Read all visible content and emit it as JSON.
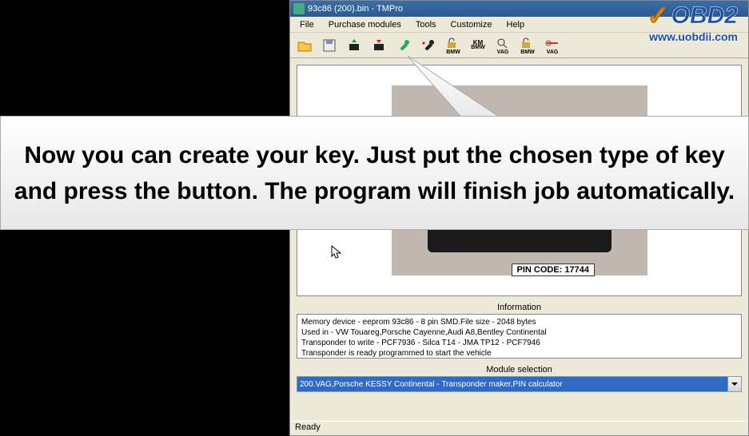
{
  "window": {
    "title": "93c86 (200).bin - TMPro"
  },
  "menu": {
    "file": "File",
    "purchase": "Purchase modules",
    "tools": "Tools",
    "customize": "Customize",
    "help": "Help"
  },
  "toolbar": {
    "bmw1": "BMW",
    "km_bmw": "KM",
    "bmw2": "BMW",
    "vag1": "VAG",
    "vag2": "VAG"
  },
  "overlay": {
    "text": "Now you can create your key. Just put the chosen type of key and press the button. The program will finish job automatically."
  },
  "pin": "PIN CODE: 17744",
  "sections": {
    "information": "Information",
    "module": "Module selection"
  },
  "info": {
    "line1": "Memory device - eeprom 93c86 - 8 pin SMD.File size - 2048 bytes",
    "line2": "Used in - VW Touareg,Porsche Cayenne,Audi A8,Bentley Continental",
    "line3": "Transponder to write - PCF7936 - Silca T14 - JMA TP12 - PCF7946",
    "line4": "Transponder is ready programmed to start the vehicle"
  },
  "module_selected": "200.VAG,Porsche KESSY Continental - Transponder maker,PIN calculator",
  "status": "Ready",
  "watermark": {
    "brand": "OBD2",
    "url": "www.uobdii.com"
  }
}
